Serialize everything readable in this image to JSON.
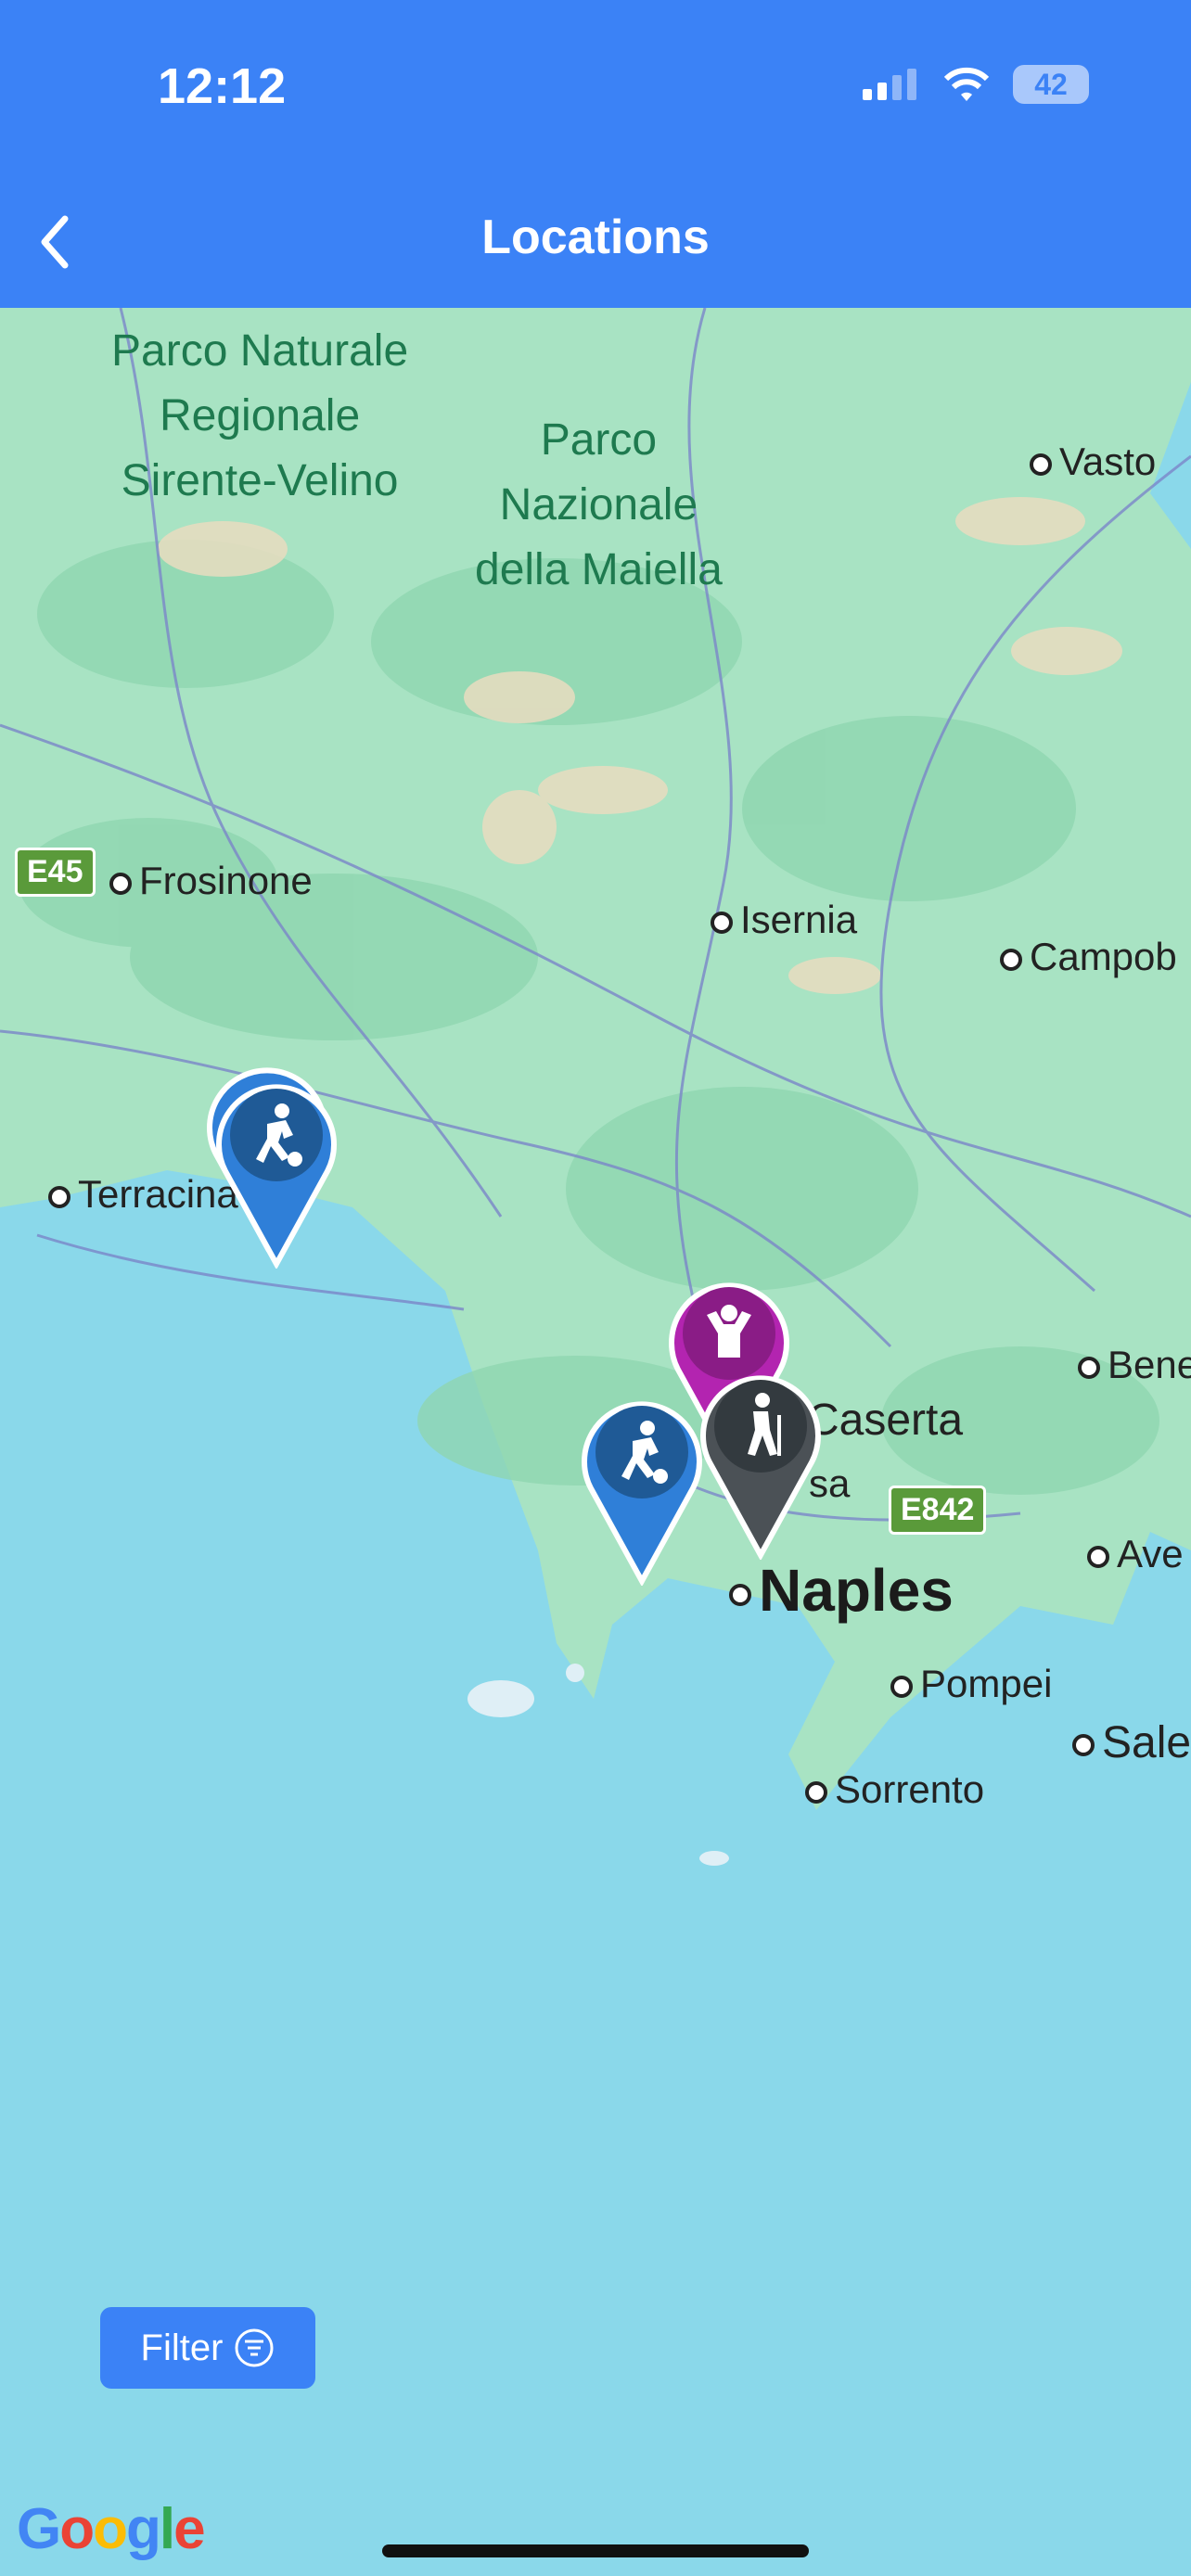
{
  "status": {
    "time": "12:12",
    "battery": "42"
  },
  "header": {
    "title": "Locations"
  },
  "map": {
    "parks": [
      "Parco Naturale\nRegionale\nSirente-Velino",
      "Parco\nNazionale\ndella Maiella"
    ],
    "cities": {
      "vasto": "Vasto",
      "frosinone": "Frosinone",
      "isernia": "Isernia",
      "campob": "Campob",
      "terracina": "Terracina",
      "bene": "Bene",
      "caserta": "Caserta",
      "aversa": "sa",
      "ave": "Ave",
      "naples": "Naples",
      "pompei": "Pompei",
      "sale": "Sale",
      "sorrento": "Sorrento"
    },
    "roads": {
      "e45": "E45",
      "e842": "E842"
    },
    "pins": [
      {
        "category": "soccer",
        "color": "#2f7fd8"
      },
      {
        "category": "kids",
        "color": "#b324b0"
      },
      {
        "category": "soccer",
        "color": "#2f7fd8"
      },
      {
        "category": "hiking",
        "color": "#4b5156"
      }
    ]
  },
  "filter": {
    "label": "Filter"
  },
  "brand": "Google"
}
